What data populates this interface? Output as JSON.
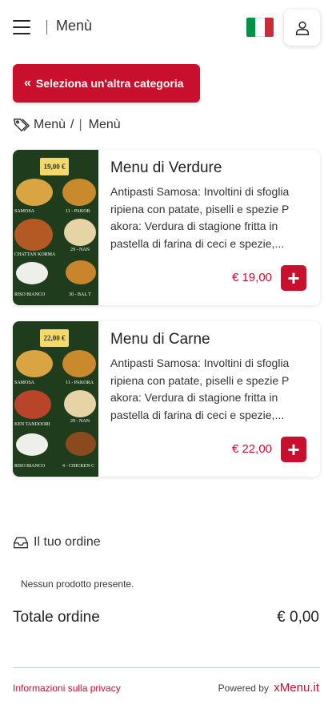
{
  "header": {
    "title": "Menù",
    "flag_colors": [
      "#009246",
      "#ffffff",
      "#ce2b37"
    ]
  },
  "category_button": {
    "icon": "«",
    "label": "Seleziona un'altra categoria"
  },
  "breadcrumb": {
    "root": "Menù",
    "separator": "/",
    "current": "Menù"
  },
  "products": [
    {
      "name": "Menu di Verdure",
      "description": "Antipasti Samosa: Involtini di sfoglia ripiena con patate, piselli e spezie P akora: Verdura di stagione fritta in pastella di farina di ceci e spezie,...",
      "price": "€ 19,00",
      "image_price": "19,00 €"
    },
    {
      "name": "Menu di Carne",
      "description": "Antipasti Samosa: Involtini di sfoglia ripiena con patate, piselli e spezie P akora: Verdura di stagione fritta in pastella di farina di ceci e spezie,...",
      "price": "€ 22,00",
      "image_price": "22,00 €"
    }
  ],
  "order": {
    "title": "Il tuo ordine",
    "empty_message": "Nessun prodotto presente.",
    "total_label": "Totale ordine",
    "total_value": "€ 0,00"
  },
  "footer": {
    "privacy_label": "Informazioni sulla privacy",
    "powered_label": "Powered by",
    "brand": "xMenu.it"
  },
  "colors": {
    "accent": "#c8102e"
  }
}
